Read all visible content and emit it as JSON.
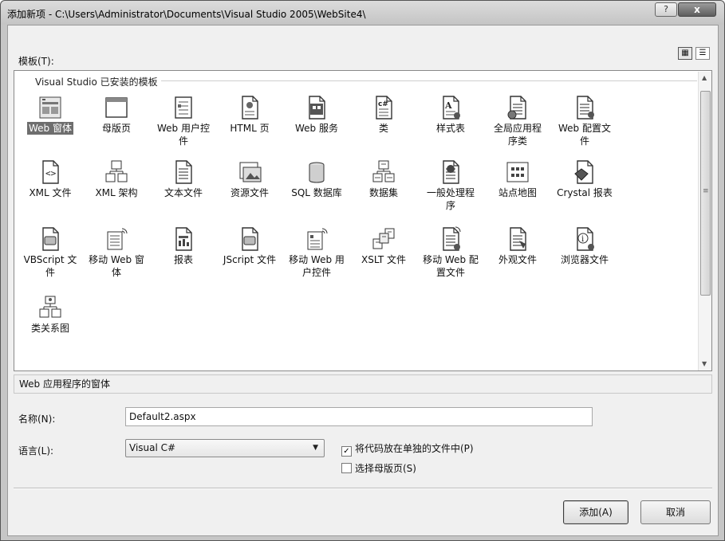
{
  "window": {
    "title": "添加新项 - C:\\Users\\Administrator\\Documents\\Visual Studio 2005\\WebSite4\\",
    "help_glyph": "?",
    "close_glyph": "x"
  },
  "templates_label": "模板(T):",
  "view_buttons": {
    "large_icons": "large-icons-view-icon",
    "small_icons": "list-view-icon"
  },
  "group_title": "Visual Studio 已安装的模板",
  "templates": [
    {
      "label": "Web 窗体",
      "icon": "web-form-icon",
      "selected": true
    },
    {
      "label": "母版页",
      "icon": "master-page-icon"
    },
    {
      "label": "Web 用户控件",
      "icon": "web-user-control-icon"
    },
    {
      "label": "HTML 页",
      "icon": "html-page-icon"
    },
    {
      "label": "Web 服务",
      "icon": "web-service-icon"
    },
    {
      "label": "类",
      "icon": "class-icon"
    },
    {
      "label": "样式表",
      "icon": "stylesheet-icon"
    },
    {
      "label": "全局应用程序类",
      "icon": "global-app-class-icon"
    },
    {
      "label": "Web 配置文件",
      "icon": "web-config-icon"
    },
    {
      "label": "XML 文件",
      "icon": "xml-file-icon"
    },
    {
      "label": "XML 架构",
      "icon": "xml-schema-icon"
    },
    {
      "label": "文本文件",
      "icon": "text-file-icon"
    },
    {
      "label": "资源文件",
      "icon": "resource-file-icon"
    },
    {
      "label": "SQL 数据库",
      "icon": "sql-database-icon"
    },
    {
      "label": "数据集",
      "icon": "dataset-icon"
    },
    {
      "label": "一般处理程序",
      "icon": "generic-handler-icon"
    },
    {
      "label": "站点地图",
      "icon": "site-map-icon"
    },
    {
      "label": "Crystal 报表",
      "icon": "crystal-report-icon"
    },
    {
      "label": "VBScript 文件",
      "icon": "vbscript-file-icon"
    },
    {
      "label": "移动 Web 窗体",
      "icon": "mobile-web-form-icon"
    },
    {
      "label": "报表",
      "icon": "report-icon"
    },
    {
      "label": "JScript 文件",
      "icon": "jscript-file-icon"
    },
    {
      "label": "移动 Web 用户控件",
      "icon": "mobile-web-user-control-icon"
    },
    {
      "label": "XSLT 文件",
      "icon": "xslt-file-icon"
    },
    {
      "label": "移动 Web 配置文件",
      "icon": "mobile-web-config-icon"
    },
    {
      "label": "外观文件",
      "icon": "skin-file-icon"
    },
    {
      "label": "浏览器文件",
      "icon": "browser-file-icon"
    },
    {
      "label": "类关系图",
      "icon": "class-diagram-icon"
    }
  ],
  "description": "Web 应用程序的窗体",
  "name_label": "名称(N):",
  "name_value": "Default2.aspx",
  "language_label": "语言(L):",
  "language_value": "Visual C#",
  "options": {
    "separate_file": {
      "label": "将代码放在单独的文件中(P)",
      "checked": true
    },
    "master_page": {
      "label": "选择母版页(S)",
      "checked": false
    }
  },
  "buttons": {
    "add": "添加(A)",
    "cancel": "取消"
  }
}
